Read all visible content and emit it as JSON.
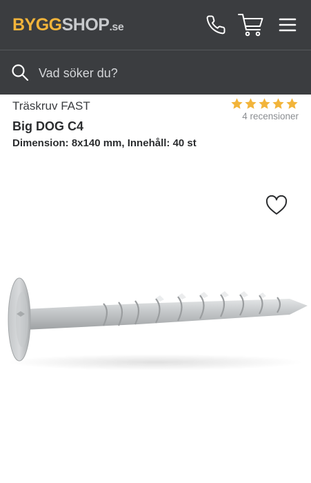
{
  "header": {
    "logo": {
      "part1": "BYGG",
      "part2": "SHOP",
      "part3": ".se"
    },
    "icons": [
      "phone-icon",
      "cart-icon",
      "menu-icon"
    ]
  },
  "search": {
    "placeholder": "Vad söker du?"
  },
  "product": {
    "category": "Träskruv FAST",
    "name": "Big DOG C4",
    "dimension": "Dimension: 8x140 mm, Innehåll: 40 st",
    "rating": {
      "stars": 5,
      "max": 5,
      "reviews_label": "4 recensioner"
    }
  },
  "colors": {
    "header_bg": "#3b3d40",
    "brand_yellow": "#f2b43a",
    "star": "#f2b43a",
    "text_dark": "#2b2d2f",
    "text_muted": "#8a8d91"
  }
}
